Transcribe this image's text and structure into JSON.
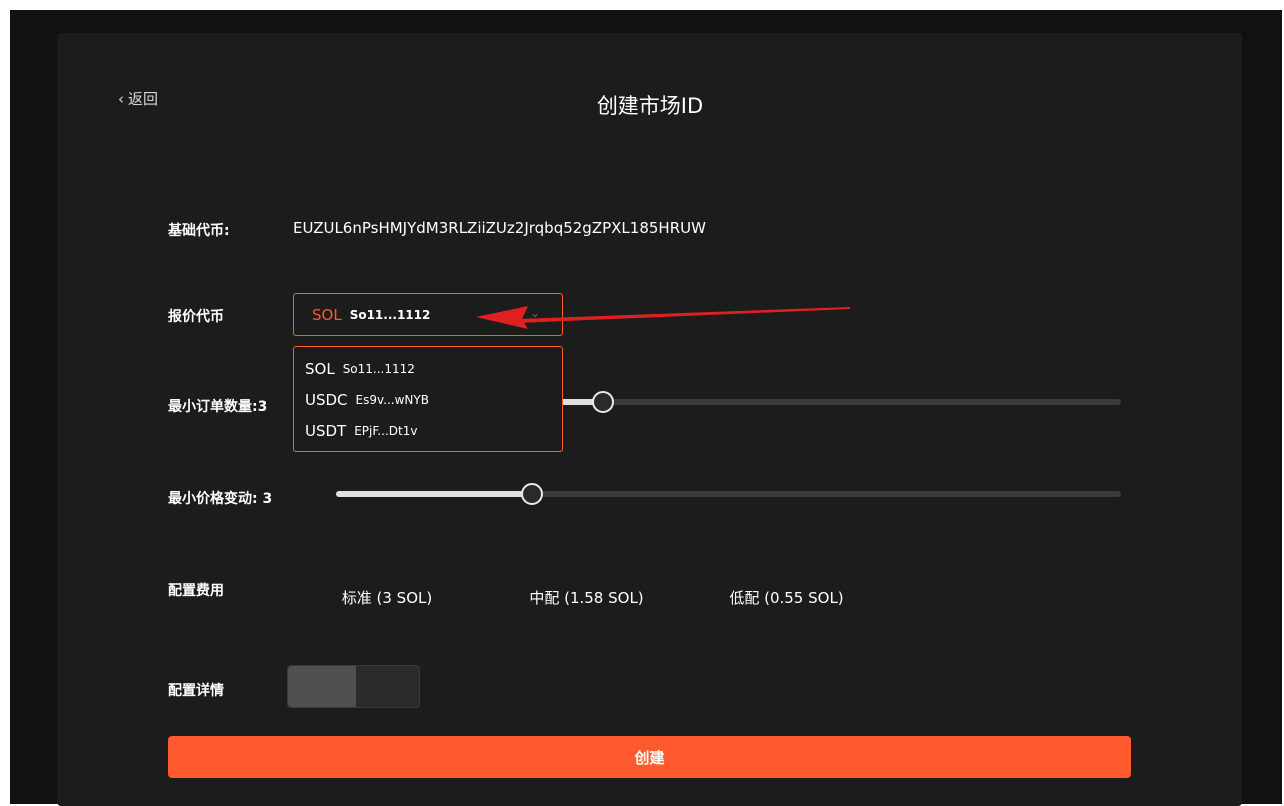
{
  "nav": {
    "back_label": "返回",
    "title": "创建市场ID"
  },
  "form": {
    "base_token_label": "基础代币:",
    "base_token_value": "EUZUL6nPsHMJYdM3RLZiiZUz2Jrqbq52gZPXL185HRUW",
    "quote_token_label": "报价代币",
    "quote_selected": {
      "symbol": "SOL",
      "address": "So11...1112"
    },
    "quote_options": [
      {
        "symbol": "SOL",
        "address": "So11...1112"
      },
      {
        "symbol": "USDC",
        "address": "Es9v...wNYB"
      },
      {
        "symbol": "USDT",
        "address": "EPjF...Dt1v"
      }
    ],
    "min_order_label": "最小订单数量:",
    "min_order_value": "3",
    "min_order_slider_fraction": 0.34,
    "min_price_label": "最小价格变动:",
    "min_price_value": "3",
    "min_price_slider_fraction": 0.25,
    "fee_label": "配置费用",
    "fee_options": [
      {
        "label": "标准 (3 SOL)",
        "active": true
      },
      {
        "label": "中配 (1.58 SOL)",
        "active": false
      },
      {
        "label": "低配 (0.55 SOL)",
        "active": false
      }
    ],
    "details_label": "配置详情",
    "details_toggle_on": false,
    "create_label": "创建"
  },
  "colors": {
    "accent": "#ff5a2e",
    "background": "#111111",
    "panel": "#1c1c1c",
    "arrow": "#e02020"
  }
}
